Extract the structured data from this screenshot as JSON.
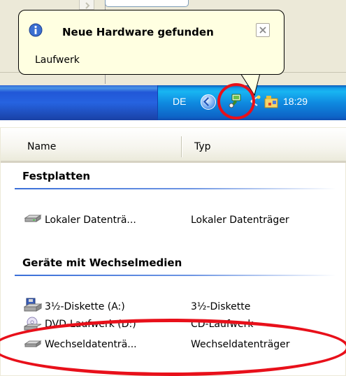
{
  "notification": {
    "title": "Neue Hardware gefunden",
    "message": "Laufwerk"
  },
  "taskbar": {
    "language": "DE",
    "clock": "18:29"
  },
  "explorer": {
    "columns": {
      "name": "Name",
      "type": "Typ"
    },
    "groups": [
      {
        "title": "Festplatten",
        "items": [
          {
            "name": "Lokaler Datenträ...",
            "type": "Lokaler Datenträger",
            "icon": "hard-disk-icon"
          }
        ]
      },
      {
        "title": "Geräte mit Wechselmedien",
        "items": [
          {
            "name": "3½-Diskette (A:)",
            "type": "3½-Diskette",
            "icon": "floppy-drive-icon"
          },
          {
            "name": "DVD-Laufwerk (D:)",
            "type": "CD-Laufwerk",
            "icon": "dvd-drive-icon"
          },
          {
            "name": "Wechseldatenträ...",
            "type": "Wechseldatenträger",
            "icon": "removable-drive-icon"
          }
        ]
      }
    ]
  },
  "colors": {
    "balloon_bg": "#ffffe1",
    "taskbar_blue": "#2663e0",
    "tray_blue": "#18b5f2",
    "highlight_red": "#e8101a",
    "group_line_blue": "#3a6fd8"
  }
}
